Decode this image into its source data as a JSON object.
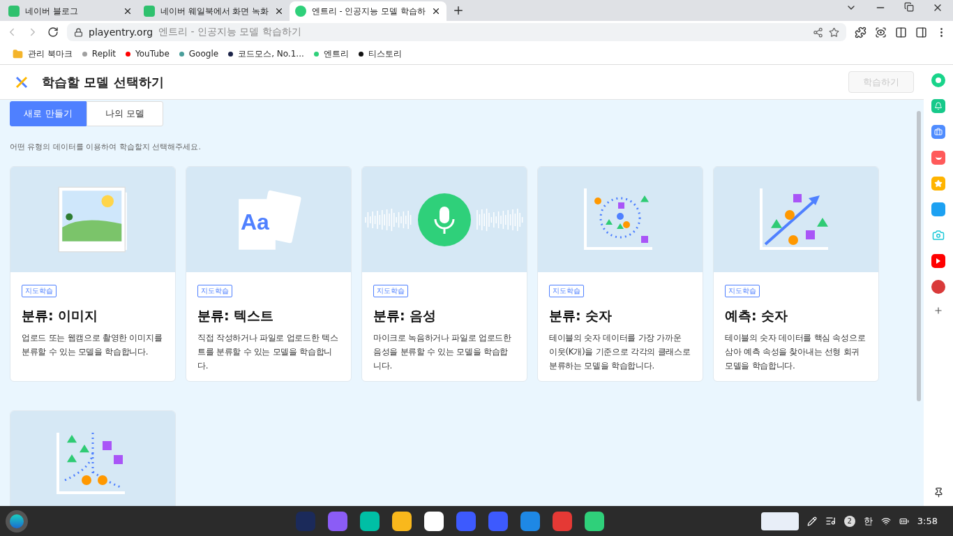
{
  "browser_tabs": [
    {
      "title": "네이버 블로그",
      "selected": false,
      "kind": "blog"
    },
    {
      "title": "네이버 웨일북에서 화면 녹화",
      "selected": false,
      "kind": "blog"
    },
    {
      "title": "엔트리 - 인공지능 모델 학습하",
      "selected": true,
      "kind": "entry"
    }
  ],
  "address": {
    "domain": "playentry.org",
    "page_title": "엔트리 - 인공지능 모델 학습하기"
  },
  "bookmarks": [
    {
      "label": "관리 북마크",
      "kind": "folder"
    },
    {
      "label": "Replit",
      "kind": "dot",
      "color": "#a0a0a0"
    },
    {
      "label": "YouTube",
      "kind": "dot",
      "color": "#ff0000"
    },
    {
      "label": "Google",
      "kind": "dot",
      "color": "#4a9e9a"
    },
    {
      "label": "코드모스, No.1...",
      "kind": "dot",
      "color": "#1c2448"
    },
    {
      "label": "엔트리",
      "kind": "dot",
      "color": "#2fd07a"
    },
    {
      "label": "티스토리",
      "kind": "dot",
      "color": "#111111"
    }
  ],
  "header": {
    "title": "학습할 모델 선택하기",
    "train_button": {
      "label": "학습하기",
      "disabled": true
    }
  },
  "mode_tabs": [
    {
      "label": "새로 만들기",
      "selected": true
    },
    {
      "label": "나의 모델",
      "selected": false
    }
  ],
  "instruction": "어떤 유형의 데이터를 이용하여 학습할지 선택해주세요.",
  "cards": [
    {
      "kind": "image",
      "tag": "지도학습",
      "title": "분류: 이미지",
      "description": "업로드 또는 웹캠으로 촬영한 이미지를 분류할 수 있는 모델을 학습합니다."
    },
    {
      "kind": "text",
      "art_text": "Aa",
      "tag": "지도학습",
      "title": "분류: 텍스트",
      "description": "직접 작성하거나 파일로 업로드한 텍스트를 분류할 수 있는 모델을 학습합니다."
    },
    {
      "kind": "sound",
      "tag": "지도학습",
      "title": "분류: 음성",
      "description": "마이크로 녹음하거나 파일로 업로드한 음성을 분류할 수 있는 모델을 학습합니다."
    },
    {
      "kind": "cluster",
      "tag": "지도학습",
      "title": "분류: 숫자",
      "description": "테이블의 숫자 데이터를 가장 가까운 이웃(K개)을 기준으로 각각의 클래스로 분류하는 모델을 학습합니다."
    },
    {
      "kind": "regression",
      "tag": "지도학습",
      "title": "예측: 숫자",
      "description": "테이블의 숫자 데이터를 핵심 속성으로 삼아 예측 속성을 찾아내는 선형 회귀 모델을 학습합니다."
    },
    {
      "kind": "scatter"
    }
  ],
  "taskbar": {
    "notification_count": "2",
    "input_method": "한",
    "time": "3:58"
  }
}
